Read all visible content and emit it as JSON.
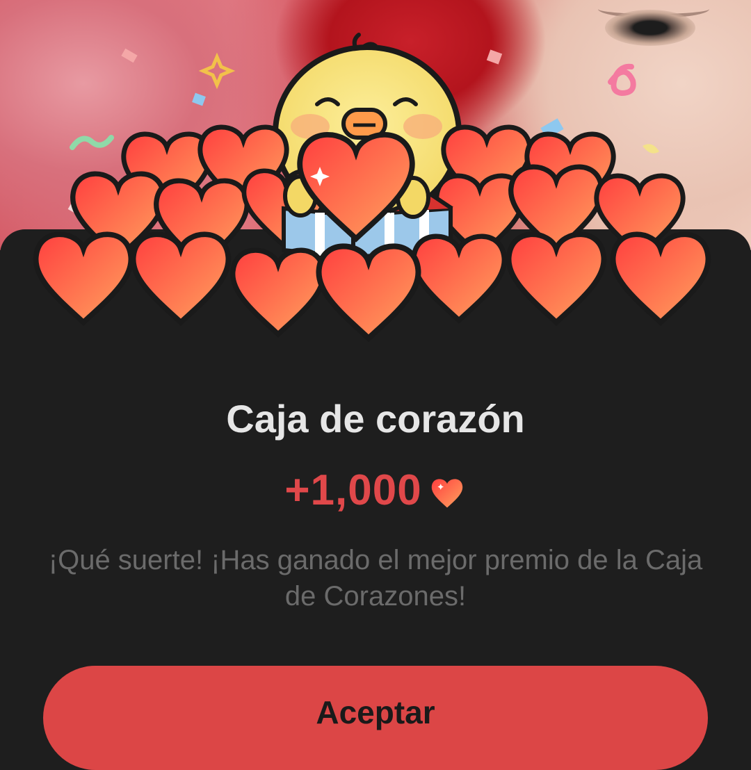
{
  "dialog": {
    "title": "Caja de corazón",
    "reward_amount": "+1,000",
    "reward_icon": "heart-icon",
    "message": "¡Qué suerte! ¡Has ganado el mejor premio de la Caja de Corazones!",
    "accept_label": "Aceptar"
  },
  "colors": {
    "accent": "#dc4646",
    "reward_text": "#e0484a",
    "heart_light": "#ff9a5a",
    "heart_dark": "#ff3f3f",
    "chick_yellow": "#f8e27a",
    "sheet_background": "#1e1e1e",
    "title_text": "#e6e6e6",
    "message_text": "#6b6b6b"
  },
  "illustration": {
    "character": "chick-holding-heart",
    "decorations": [
      "confetti",
      "hearts-pile",
      "gift-box",
      "sparkle"
    ]
  }
}
